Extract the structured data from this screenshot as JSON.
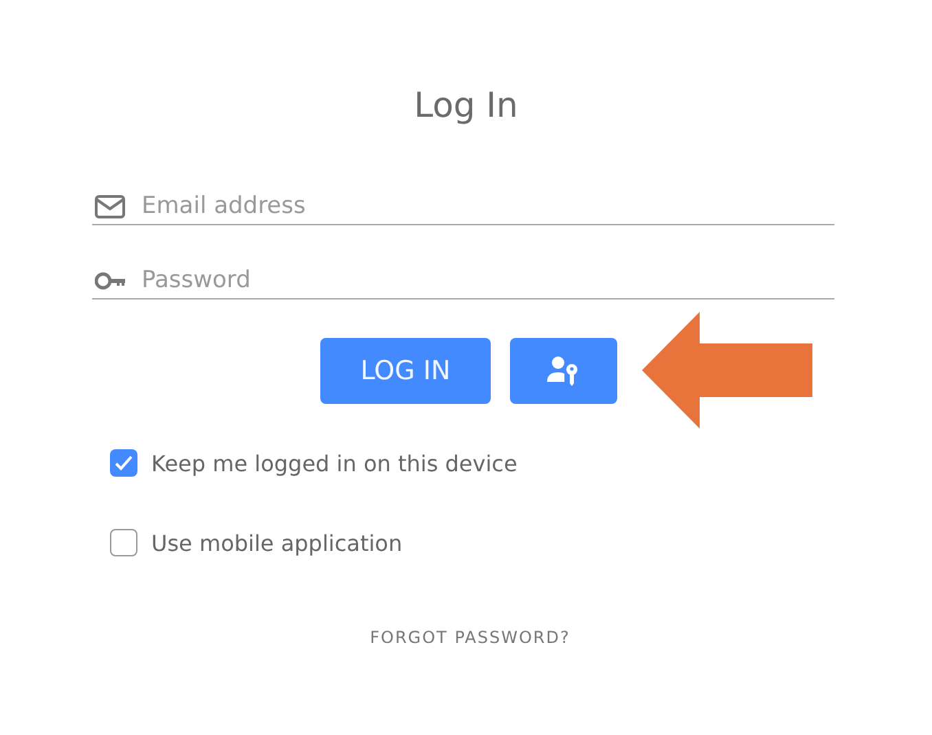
{
  "title": "Log In",
  "fields": [
    {
      "kind": "email",
      "placeholder": "Email address"
    },
    {
      "kind": "password",
      "placeholder": "Password"
    }
  ],
  "buttons": [
    {
      "kind": "text",
      "label": "LOG IN"
    },
    {
      "kind": "icon"
    }
  ],
  "annotation": {
    "kind": "arrow"
  },
  "options": [
    {
      "label": "Keep me logged in on this device",
      "checked": true
    },
    {
      "label": "Use mobile application",
      "checked": false
    }
  ],
  "forgot_link": "FORGOT PASSWORD?"
}
